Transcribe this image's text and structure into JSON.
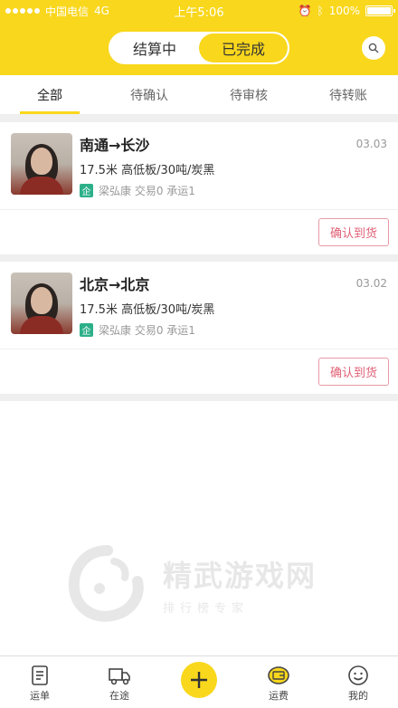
{
  "status_bar": {
    "carrier": "中国电信",
    "network": "4G",
    "time": "上午5:06",
    "battery": "100%",
    "battery_level": 1.0
  },
  "header": {
    "segment_active": "结算中",
    "segment_inactive": "已完成",
    "search_icon": "search-icon"
  },
  "tabs": [
    {
      "label": "全部",
      "active": true
    },
    {
      "label": "待确认",
      "active": false
    },
    {
      "label": "待审核",
      "active": false
    },
    {
      "label": "待转账",
      "active": false
    }
  ],
  "orders": [
    {
      "route": "南通→长沙",
      "date": "03.03",
      "spec": "17.5米   高低板/30吨/炭黑",
      "company_badge": "企",
      "owner": "梁弘康 交易0 承运1",
      "action": "确认到货"
    },
    {
      "route": "北京→北京",
      "date": "03.02",
      "spec": "17.5米   高低板/30吨/炭黑",
      "company_badge": "企",
      "owner": "梁弘康 交易0 承运1",
      "action": "确认到货"
    }
  ],
  "watermark": {
    "title": "精武游戏网",
    "subtitle": "排行榜专家"
  },
  "bottom_nav": [
    {
      "label": "运单",
      "icon": "document-icon"
    },
    {
      "label": "在途",
      "icon": "truck-icon"
    },
    {
      "label": "",
      "icon": "plus-icon"
    },
    {
      "label": "运费",
      "icon": "wallet-icon"
    },
    {
      "label": "我的",
      "icon": "smiley-icon"
    }
  ],
  "colors": {
    "brand_yellow": "#f9d71c",
    "confirm_pink": "#e06076",
    "badge_green": "#2db08a"
  }
}
